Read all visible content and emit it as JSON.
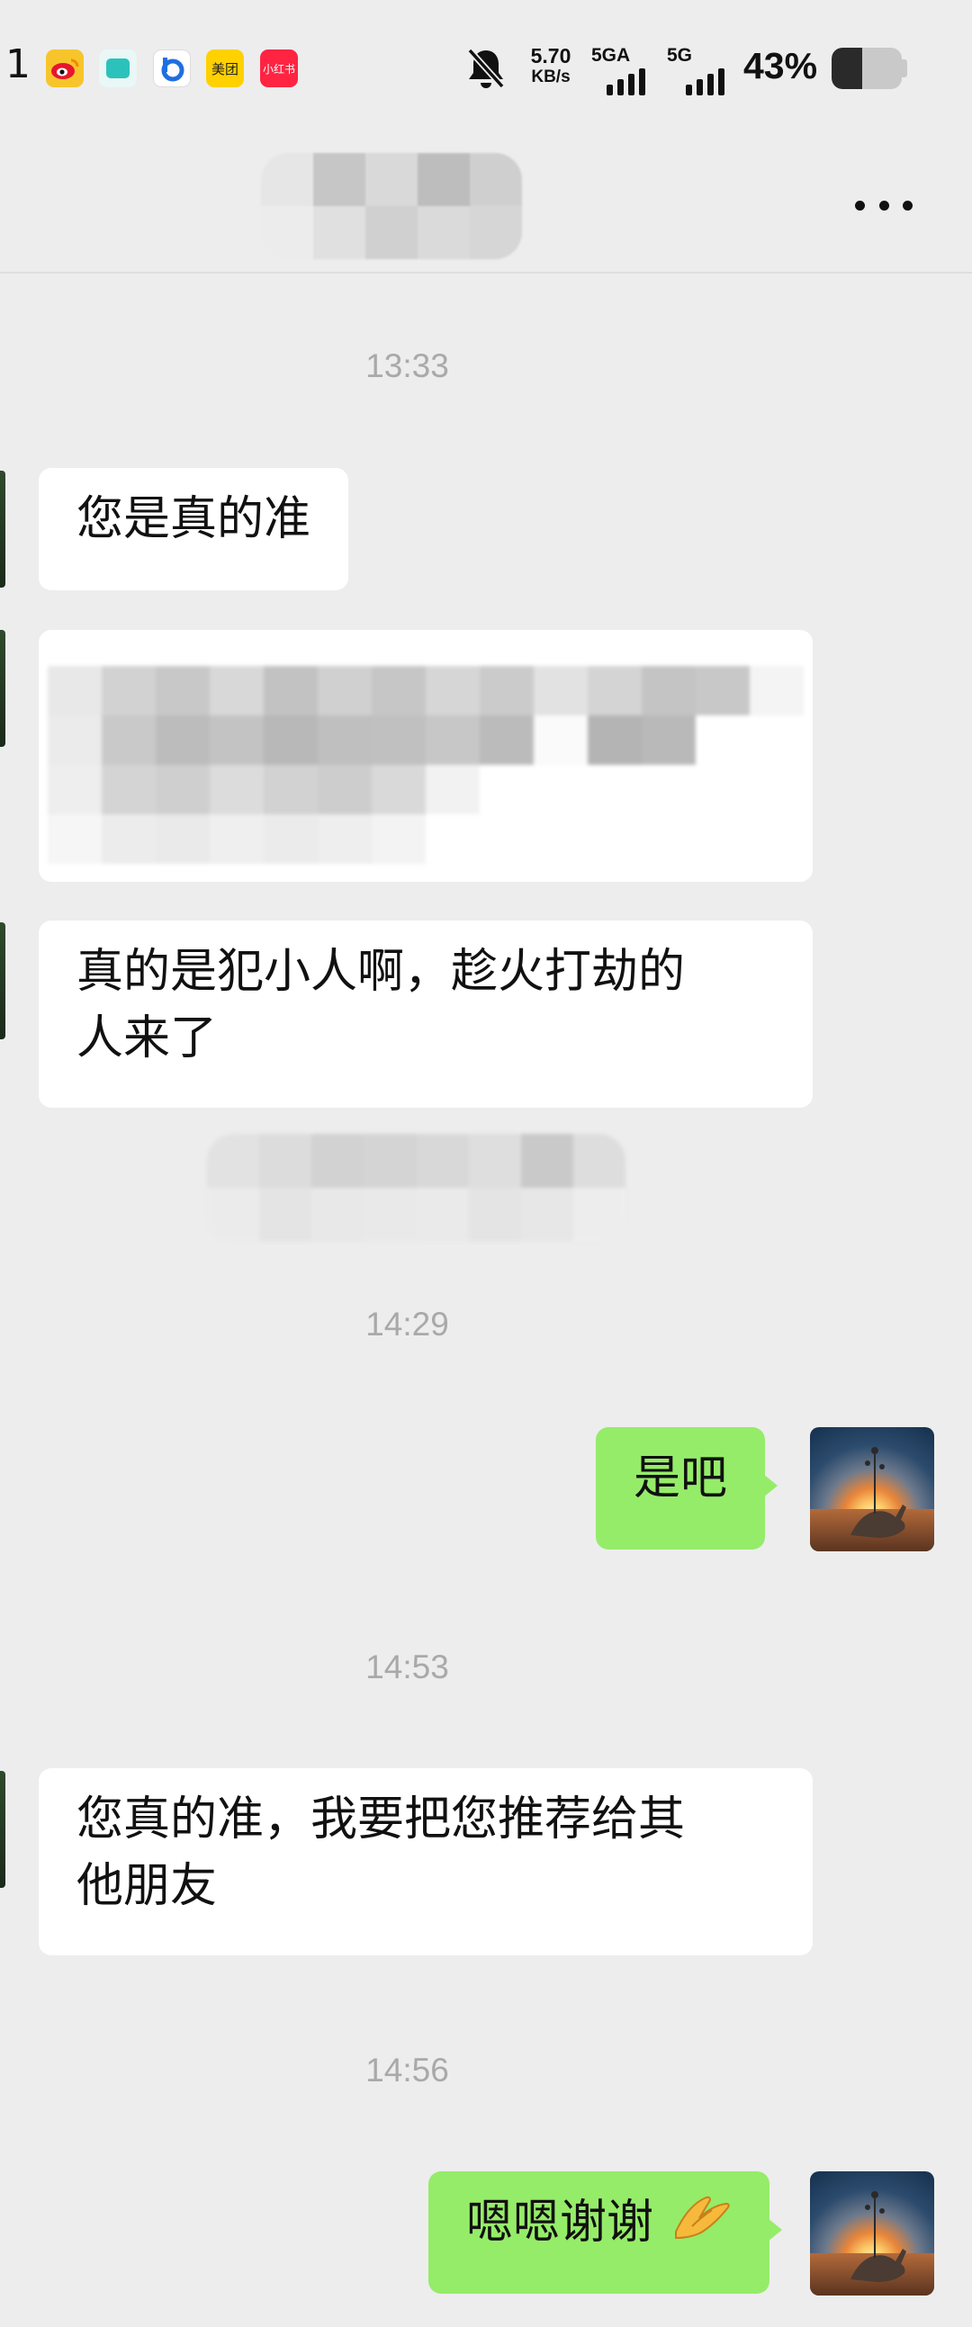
{
  "status_bar": {
    "time": "1",
    "apps": [
      {
        "name": "weibo",
        "color": "#f7c52b",
        "label": ""
      },
      {
        "name": "app-cyan",
        "color": "#33c7c2",
        "label": ""
      },
      {
        "name": "app-blue",
        "color": "#1f6fe0",
        "label": ""
      },
      {
        "name": "meituan",
        "color": "#ffd100",
        "label": "美团"
      },
      {
        "name": "xiaohongshu",
        "color": "#ff2442",
        "label": "小红书"
      }
    ],
    "speed_value": "5.70",
    "speed_unit": "KB/s",
    "net1": "5GA",
    "net2": "5G",
    "battery_percent": "43%",
    "battery_level": 0.43
  },
  "header": {
    "more_label": "more options"
  },
  "messages": {
    "ts1": "13:33",
    "m1": "您是真的准",
    "m3_line1": "真的是犯小人啊，趁火打劫的",
    "m3_line2": "人来了",
    "ts2": "14:29",
    "m4": "是吧",
    "ts3": "14:53",
    "m5_line1": "您真的准，我要把您推荐给其",
    "m5_line2": "他朋友",
    "ts4": "14:56",
    "m6": "嗯嗯谢谢"
  },
  "icons": {
    "mute": "bell-off-icon",
    "more": "more-dots-icon",
    "emoji": "folded-hands-emoji"
  },
  "colors": {
    "background": "#ededed",
    "my_bubble": "#95ec69",
    "their_bubble": "#ffffff",
    "timestamp": "#a9a9a9"
  }
}
